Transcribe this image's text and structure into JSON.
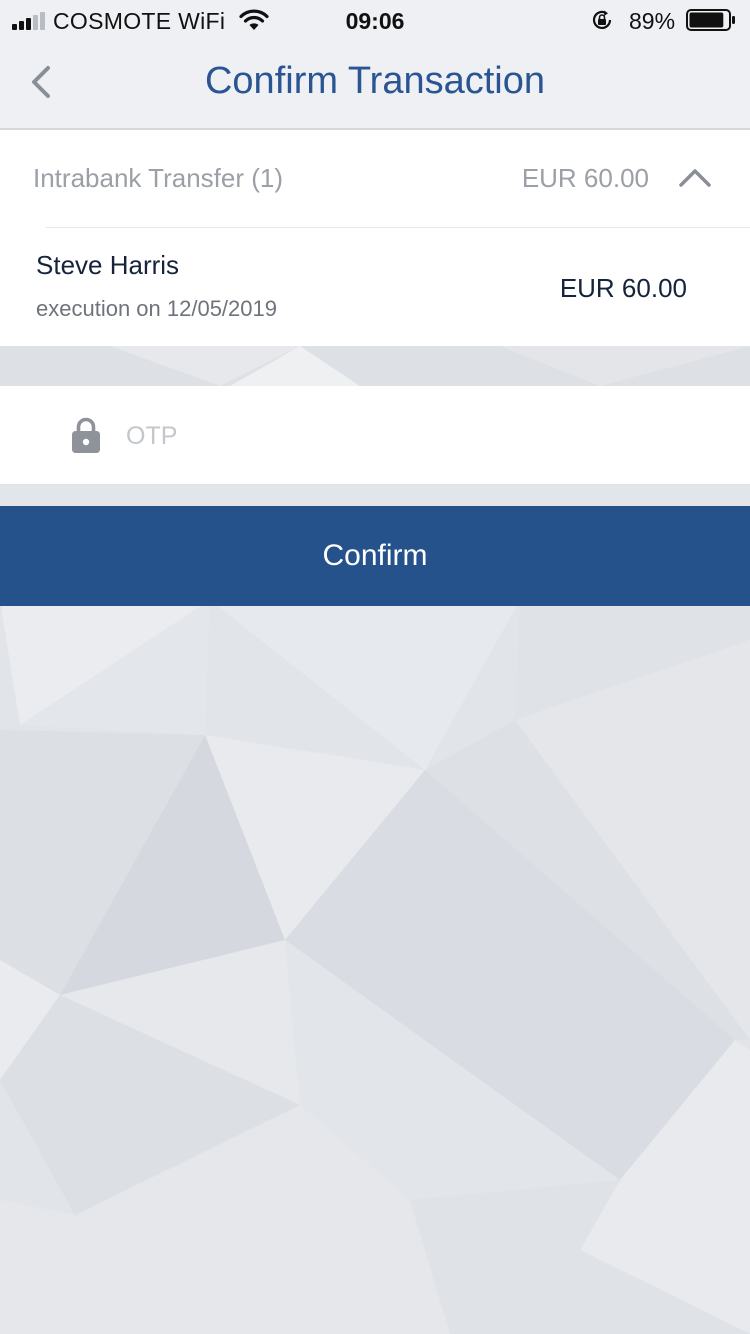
{
  "status_bar": {
    "carrier": "COSMOTE WiFi",
    "time": "09:06",
    "battery_percent": "89%",
    "battery_level": 0.89,
    "signal_bars_filled": 3,
    "signal_bars_total": 5
  },
  "header": {
    "title": "Confirm Transaction",
    "back_icon": "chevron-left-icon"
  },
  "transaction_group": {
    "label": "Intrabank Transfer (1)",
    "total": "EUR 60.00",
    "expanded": true,
    "items": [
      {
        "name": "Steve Harris",
        "execution": "execution on 12/05/2019",
        "amount": "EUR 60.00"
      }
    ]
  },
  "otp": {
    "placeholder": "OTP",
    "value": "",
    "icon": "lock-icon"
  },
  "confirm_button": {
    "label": "Confirm"
  },
  "colors": {
    "accent": "#26528c",
    "title": "#2a5592",
    "muted_text": "#9b9fa6",
    "background": "#e3e6eb"
  }
}
